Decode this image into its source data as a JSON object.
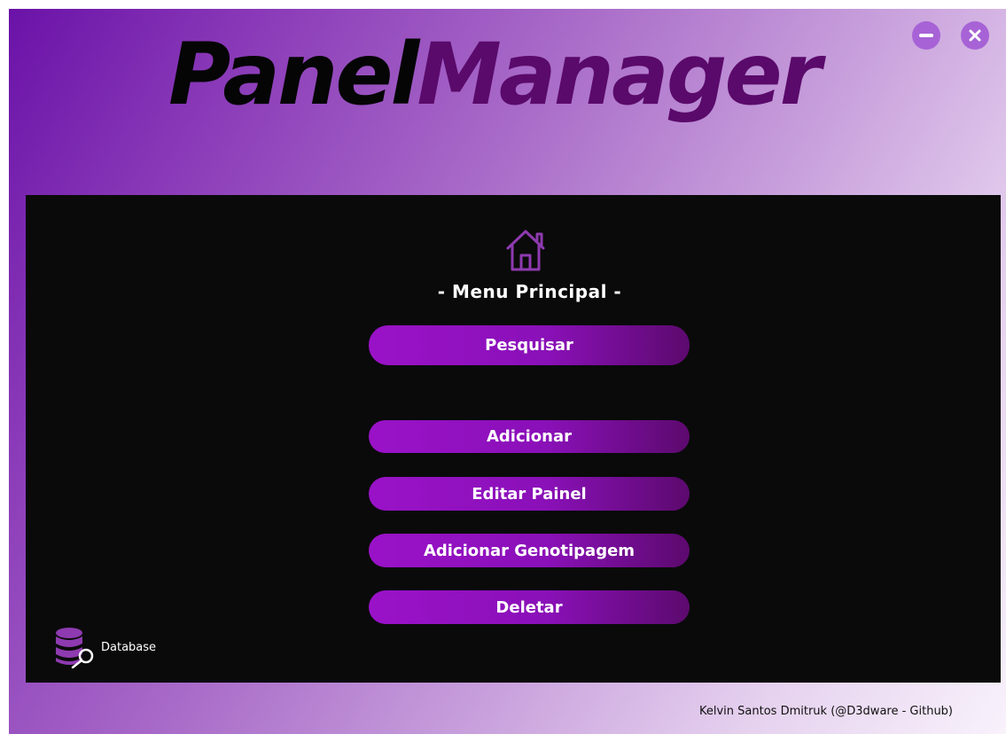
{
  "window": {
    "minimize_label": "minimize",
    "close_label": "close"
  },
  "brand": {
    "part1": "Panel",
    "part2": "Manager"
  },
  "menu": {
    "title": "- Menu Principal -",
    "buttons": [
      {
        "label": "Pesquisar"
      },
      {
        "label": "Adicionar"
      },
      {
        "label": "Editar Painel"
      },
      {
        "label": "Adicionar Genotipagem"
      },
      {
        "label": "Deletar"
      }
    ]
  },
  "database": {
    "label": "Database"
  },
  "footer": {
    "credit": "Kelvin Santos Dmitruk (@D3dware - Github)"
  },
  "icons": {
    "home": "home-icon",
    "database": "database-key-icon",
    "minimize": "minus-icon",
    "close": "close-icon"
  },
  "colors": {
    "accent": "#9a12c8",
    "accent_dark": "#5c0a6e",
    "brand_manager": "#5a0a6a",
    "panel_bg": "#0a0a0a",
    "window_btn": "#a763d6"
  }
}
